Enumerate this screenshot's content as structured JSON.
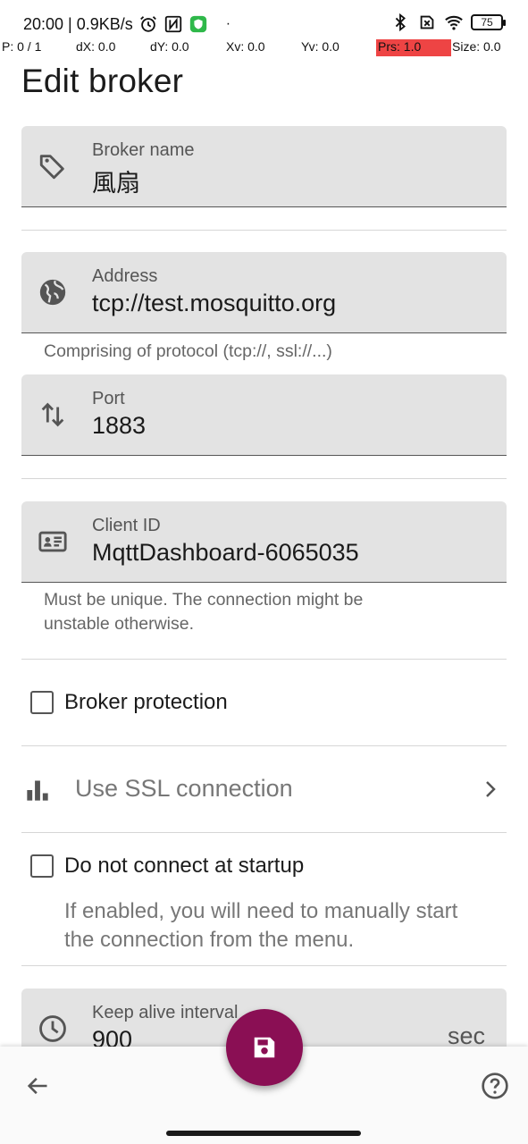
{
  "status_bar": {
    "time_speed": "20:00 | 0.9KB/s",
    "dot": "·",
    "battery": "75",
    "icons": [
      "alarm-icon",
      "nfc-icon",
      "vpn-shield-icon",
      "bluetooth-icon",
      "no-sim-icon",
      "wifi-icon",
      "battery-icon"
    ]
  },
  "debug": {
    "p": "P: 0 / 1",
    "dx": "dX: 0.0",
    "dy": "dY: 0.0",
    "xv": "Xv: 0.0",
    "yv": "Yv: 0.0",
    "prs": "Prs: 1.0",
    "size": "Size: 0.0"
  },
  "page": {
    "title": "Edit broker"
  },
  "fields": {
    "broker_name": {
      "label": "Broker name",
      "value": "風扇",
      "icon": "tag-icon"
    },
    "address": {
      "label": "Address",
      "value": "tcp://test.mosquitto.org",
      "icon": "globe-icon",
      "helper": "Comprising of protocol (tcp://, ssl://...)"
    },
    "port": {
      "label": "Port",
      "value": "1883",
      "icon": "swap-vertical-icon"
    },
    "client_id": {
      "label": "Client ID",
      "value": "MqttDashboard-6065035",
      "icon": "id-card-icon",
      "helper_line1": "Must be unique. The connection might be",
      "helper_line2": "unstable otherwise."
    },
    "keep_alive": {
      "label": "Keep alive interval",
      "value": "900",
      "unit": "sec",
      "icon": "clock-icon"
    }
  },
  "broker_protection": {
    "label": "Broker protection",
    "checked": false
  },
  "ssl": {
    "label": "Use SSL connection",
    "icon": "bar-chart-icon"
  },
  "no_connect": {
    "label": "Do not connect at startup",
    "checked": false,
    "helper_line1": "If enabled, you will need to manually start",
    "helper_line2": "the connection from the menu."
  },
  "bottom": {
    "back_icon": "back-arrow-icon",
    "save_icon": "save-icon",
    "help_icon": "help-icon"
  },
  "colors": {
    "accent": "#8a0f54",
    "field_bg": "#e3e3e3",
    "debug_highlight": "#ee4444"
  }
}
